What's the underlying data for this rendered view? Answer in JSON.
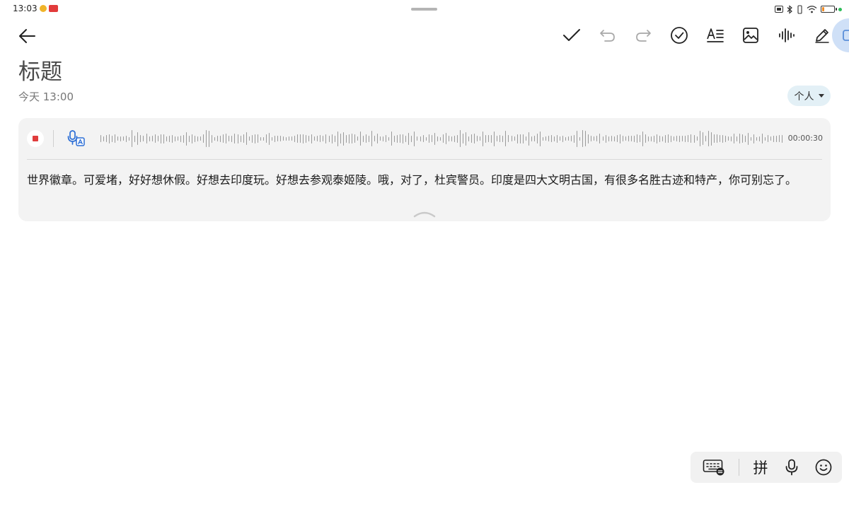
{
  "status_bar": {
    "time": "13:03",
    "battery_level": 0.2,
    "icons": [
      "app-notification-icon",
      "app-badge-icon",
      "nfc-icon",
      "bluetooth-icon",
      "wifi-icon",
      "battery-icon"
    ]
  },
  "toolbar": {
    "back_icon": "arrow-left-icon",
    "actions": [
      "check-icon",
      "undo-icon",
      "redo-icon",
      "checklist-icon",
      "text-format-icon",
      "image-icon",
      "voice-wave-icon",
      "pen-icon"
    ]
  },
  "note": {
    "title": "标题",
    "timestamp": "今天 13:00",
    "category": "个人"
  },
  "recording": {
    "duration": "00:00:30",
    "transcript": "世界徽章。可爱堵，好好想休假。好想去印度玩。好想去参观泰姬陵。哦，对了，杜宾警员。印度是四大文明古国，有很多名胜古迹和特产，你可别忘了。",
    "colors": {
      "stop": "#e03c3c",
      "transcribe": "#2d6fd6"
    }
  },
  "ime": {
    "pinyin_label": "拼"
  }
}
